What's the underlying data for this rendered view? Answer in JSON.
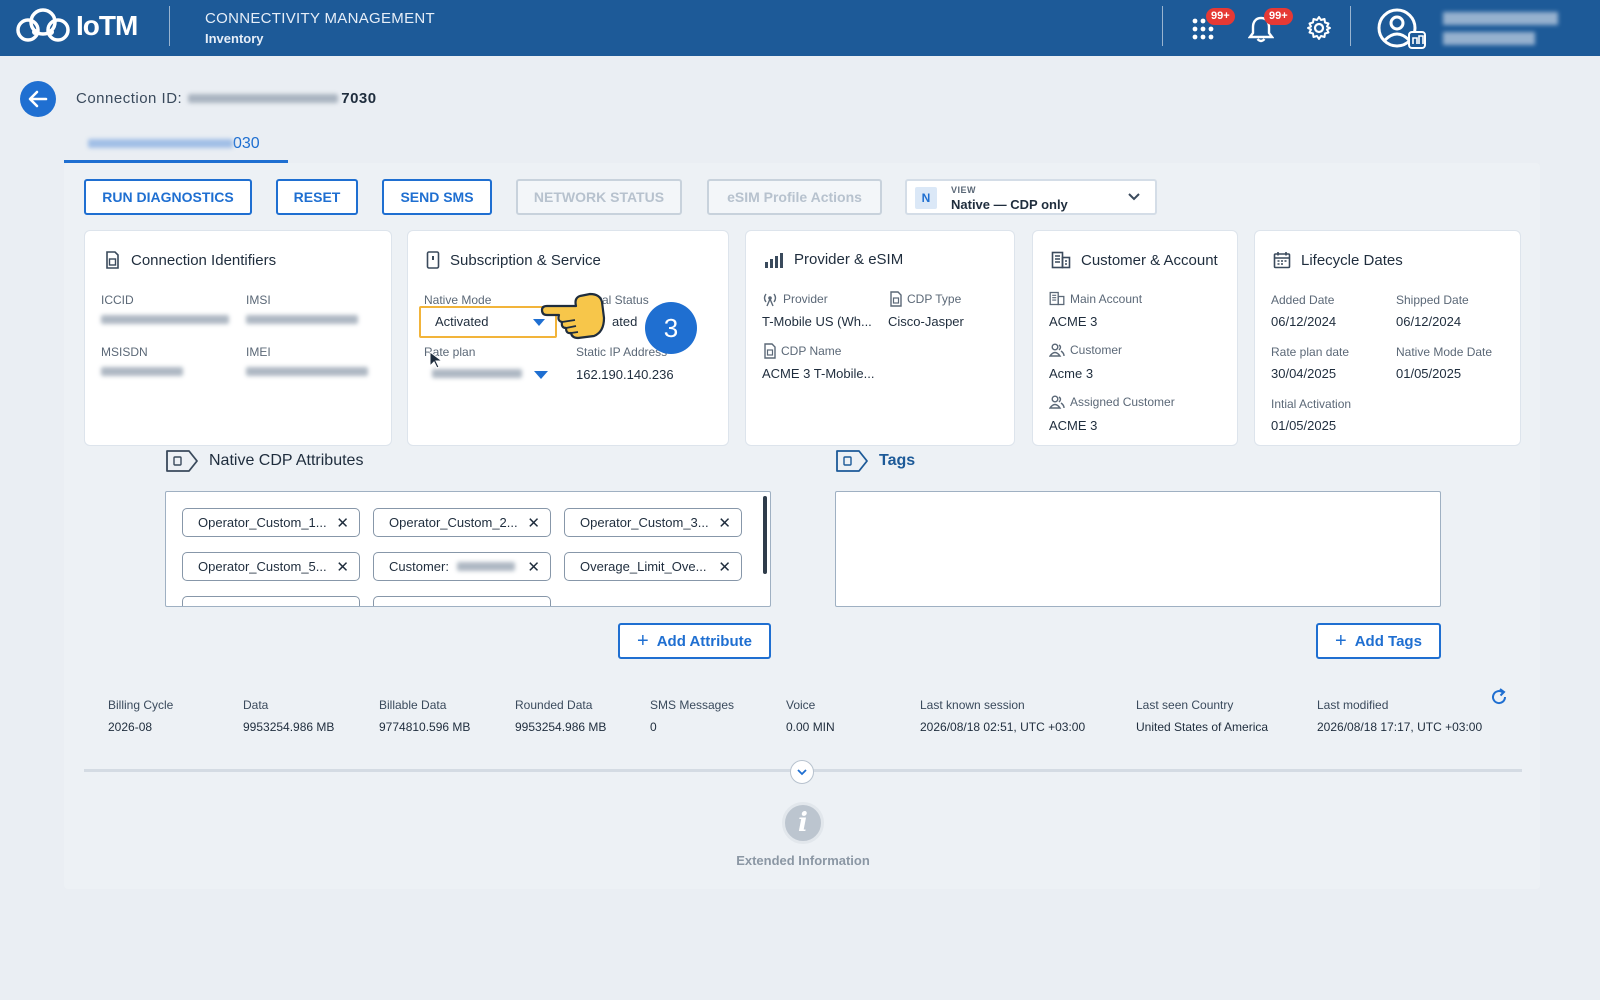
{
  "header": {
    "logo_text": "IoTM",
    "app_title": "CONNECTIVITY MANAGEMENT",
    "section": "Inventory",
    "apps_badge": "99+",
    "notifications_badge": "99+"
  },
  "connection": {
    "label": "Connection ID:",
    "id_tail": "7030",
    "tab_tail": "030"
  },
  "actions": {
    "run_diagnostics": "RUN DIAGNOSTICS",
    "reset": "RESET",
    "send_sms": "SEND SMS",
    "network_status": "NETWORK STATUS",
    "esim_profile_actions": "eSIM Profile Actions"
  },
  "view_select": {
    "badge": "N",
    "label": "VIEW",
    "value": "Native — CDP only"
  },
  "cards": {
    "identifiers": {
      "title": "Connection Identifiers",
      "iccid_label": "ICCID",
      "imsi_label": "IMSI",
      "msisdn_label": "MSISDN",
      "imei_label": "IMEI"
    },
    "subscription": {
      "title": "Subscription & Service",
      "native_mode_label": "Native Mode",
      "native_mode_value": "Activated",
      "general_status_label": "ral Status",
      "general_status_value": "ated",
      "rate_plan_label": "Rate plan",
      "static_ip_label": "Static IP Address",
      "static_ip_value": "162.190.140.236"
    },
    "provider": {
      "title": "Provider & eSIM",
      "provider_label": "Provider",
      "provider_value": "T-Mobile US (Wh...",
      "cdp_type_label": "CDP Type",
      "cdp_type_value": "Cisco-Jasper",
      "cdp_name_label": "CDP Name",
      "cdp_name_value": "ACME 3 T-Mobile..."
    },
    "customer": {
      "title": "Customer & Account",
      "main_account_label": "Main Account",
      "main_account_value": "ACME 3",
      "customer_label": "Customer",
      "customer_value": "Acme 3",
      "assigned_customer_label": "Assigned Customer",
      "assigned_customer_value": "ACME 3"
    },
    "lifecycle": {
      "title": "Lifecycle Dates",
      "added_label": "Added Date",
      "added_value": "06/12/2024",
      "shipped_label": "Shipped Date",
      "shipped_value": "06/12/2024",
      "rate_plan_date_label": "Rate plan date",
      "rate_plan_date_value": "30/04/2025",
      "native_mode_date_label": "Native Mode Date",
      "native_mode_date_value": "01/05/2025",
      "initial_activation_label": "Intial Activation",
      "initial_activation_value": "01/05/2025"
    }
  },
  "step_marker": "3",
  "attributes": {
    "title": "Native CDP Attributes",
    "chips": [
      "Operator_Custom_1...",
      "Operator_Custom_2...",
      "Operator_Custom_3...",
      "Operator_Custom_5...",
      "Customer:",
      "Overage_Limit_Ove..."
    ],
    "add_label": "Add Attribute"
  },
  "tags": {
    "title": "Tags",
    "add_label": "Add Tags"
  },
  "stats": [
    {
      "label": "Billing Cycle",
      "value": "2026-08"
    },
    {
      "label": "Data",
      "value": "9953254.986 MB"
    },
    {
      "label": "Billable Data",
      "value": "9774810.596 MB"
    },
    {
      "label": "Rounded Data",
      "value": "9953254.986 MB"
    },
    {
      "label": "SMS Messages",
      "value": "0"
    },
    {
      "label": "Voice",
      "value": "0.00 MIN"
    },
    {
      "label": "Last known session",
      "value": "2026/08/18 02:51, UTC +03:00"
    },
    {
      "label": "Last seen Country",
      "value": "United States of America"
    },
    {
      "label": "Last modified",
      "value": "2026/08/18 17:17, UTC +03:00"
    }
  ],
  "extended_label": "Extended Information",
  "colors": {
    "header_bg": "#1d5a98",
    "accent": "#1f6fd1",
    "badge": "#e53935",
    "highlight": "#f2b43a"
  }
}
